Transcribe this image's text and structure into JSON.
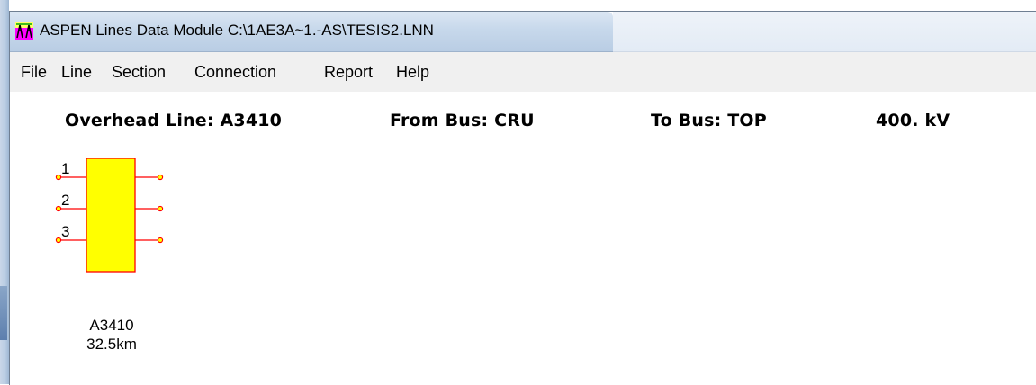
{
  "window": {
    "title": "ASPEN Lines Data Module C:\\1AE3A~1.-AS\\TESIS2.LNN",
    "app_icon": "aspen-app-icon"
  },
  "menu": [
    {
      "label": "File"
    },
    {
      "label": "Line"
    },
    {
      "label": "Section"
    },
    {
      "label": "Connection"
    },
    {
      "label": "Report"
    },
    {
      "label": "Help"
    }
  ],
  "header": {
    "line": "Overhead Line: A3410",
    "from_bus": "From Bus: CRU",
    "to_bus": "To Bus: TOP",
    "voltage": "400. kV"
  },
  "diagram": {
    "terminals": [
      "1",
      "2",
      "3"
    ],
    "line_name": "A3410",
    "length": "32.5km",
    "colors": {
      "block_fill": "#ffff00",
      "block_border": "#ff0000",
      "wire": "#ff0000",
      "terminal_fill": "#ffff00"
    }
  }
}
